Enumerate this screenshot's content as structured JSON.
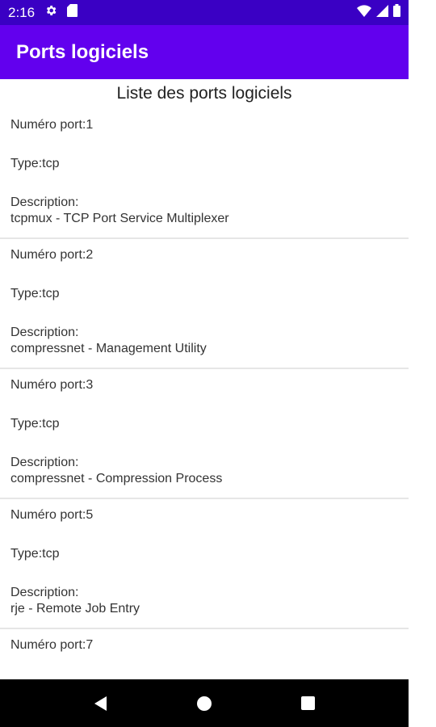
{
  "status_bar": {
    "time": "2:16",
    "icons": [
      "gear-icon",
      "sd-card-icon",
      "wifi-icon",
      "signal-icon",
      "battery-icon"
    ]
  },
  "app_bar": {
    "title": "Ports logiciels"
  },
  "list": {
    "title": "Liste des ports logiciels",
    "items": [
      {
        "port": "Numéro port:1",
        "type": "Type:tcp",
        "desc_label": "Description:",
        "desc": "tcpmux - TCP Port Service Multiplexer"
      },
      {
        "port": "Numéro port:2",
        "type": "Type:tcp",
        "desc_label": "Description:",
        "desc": "compressnet - Management Utility"
      },
      {
        "port": "Numéro port:3",
        "type": "Type:tcp",
        "desc_label": "Description:",
        "desc": "compressnet - Compression Process"
      },
      {
        "port": "Numéro port:5",
        "type": "Type:tcp",
        "desc_label": "Description:",
        "desc": "rje - Remote Job Entry"
      },
      {
        "port": "Numéro port:7"
      }
    ]
  },
  "nav_bar": {
    "icons": [
      "back-icon",
      "home-icon",
      "recents-icon"
    ]
  },
  "colors": {
    "status_bar": "#3a00c4",
    "app_bar": "#6200ee",
    "nav_bar": "#000000"
  }
}
